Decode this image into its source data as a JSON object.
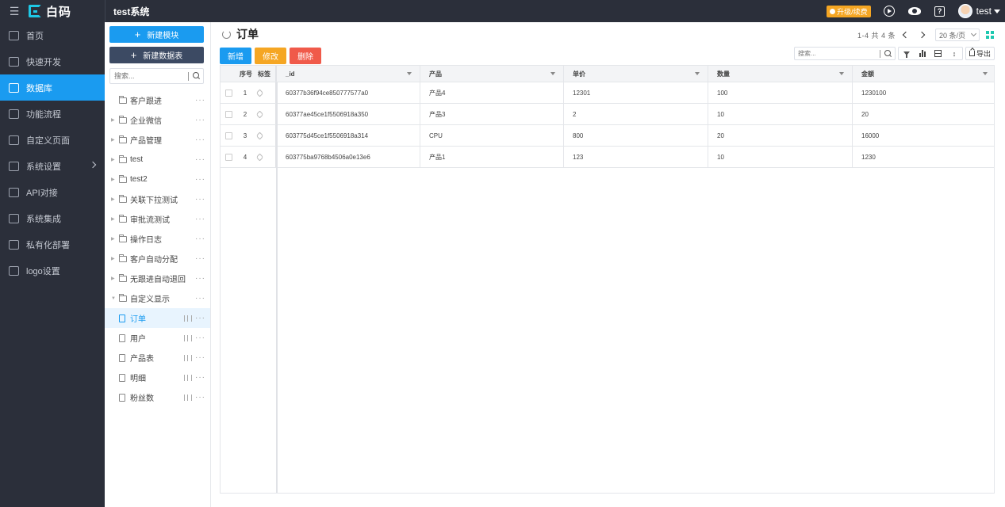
{
  "topbar": {
    "app_name": "白码",
    "system_name": "test系统",
    "upgrade_label": "升级/续费",
    "user_name": "test"
  },
  "nav": {
    "items": [
      {
        "label": "首页",
        "icon": "home-icon"
      },
      {
        "label": "快速开发",
        "icon": "cube-icon"
      },
      {
        "label": "数据库",
        "icon": "database-icon",
        "active": true
      },
      {
        "label": "功能流程",
        "icon": "flow-icon"
      },
      {
        "label": "自定义页面",
        "icon": "page-icon"
      },
      {
        "label": "系统设置",
        "icon": "monitor-icon",
        "has_children": true
      },
      {
        "label": "API对接",
        "icon": "api-icon"
      },
      {
        "label": "系统集成",
        "icon": "layers-icon"
      },
      {
        "label": "私有化部署",
        "icon": "server-icon"
      },
      {
        "label": "logo设置",
        "icon": "logo-icon"
      }
    ]
  },
  "tree": {
    "new_module_label": "新建模块",
    "new_table_label": "新建数据表",
    "search_placeholder": "搜索...",
    "folders": [
      {
        "label": "客户跟进",
        "expandable": false
      },
      {
        "label": "企业微信",
        "expandable": true
      },
      {
        "label": "产品管理",
        "expandable": true
      },
      {
        "label": "test",
        "expandable": true
      },
      {
        "label": "test2",
        "expandable": true
      },
      {
        "label": "关联下拉测试",
        "expandable": true
      },
      {
        "label": "审批流测试",
        "expandable": true
      },
      {
        "label": "操作日志",
        "expandable": true
      },
      {
        "label": "客户自动分配",
        "expandable": true
      },
      {
        "label": "无跟进自动退回",
        "expandable": true
      },
      {
        "label": "自定义显示",
        "expandable": true,
        "expanded": true
      }
    ],
    "tables": [
      {
        "label": "订单",
        "selected": true
      },
      {
        "label": "用户"
      },
      {
        "label": "产品表"
      },
      {
        "label": "明细"
      },
      {
        "label": "粉丝数"
      }
    ],
    "more_glyph": "···"
  },
  "main": {
    "title": "订单",
    "pager": {
      "range": "1-4 共 4 条",
      "page_size": "20 条/页"
    },
    "actions": {
      "add": "新增",
      "edit": "修改",
      "delete": "删除"
    },
    "search_placeholder": "搜索...",
    "export_label": "导出",
    "table": {
      "fixed_headers": {
        "seq": "序号",
        "tag": "标签"
      },
      "columns": [
        "_id",
        "产品",
        "单价",
        "数量",
        "金额"
      ],
      "rows": [
        {
          "seq": "1",
          "cells": [
            "60377b36f94ce850777577a0",
            "产品4",
            "12301",
            "100",
            "1230100"
          ]
        },
        {
          "seq": "2",
          "cells": [
            "60377ae45ce1f5506918a350",
            "产品3",
            "2",
            "10",
            "20"
          ]
        },
        {
          "seq": "3",
          "cells": [
            "603775d45ce1f5506918a314",
            "CPU",
            "800",
            "20",
            "16000"
          ]
        },
        {
          "seq": "4",
          "cells": [
            "603775ba9768b4506a0e13e6",
            "产品1",
            "123",
            "10",
            "1230"
          ]
        }
      ]
    }
  },
  "colors": {
    "accent": "#1a9bf0",
    "sidebar_bg": "#2b2f3a",
    "edit_btn": "#f5a623",
    "delete_btn": "#f05a4a",
    "upgrade_badge": "#f5a623"
  }
}
